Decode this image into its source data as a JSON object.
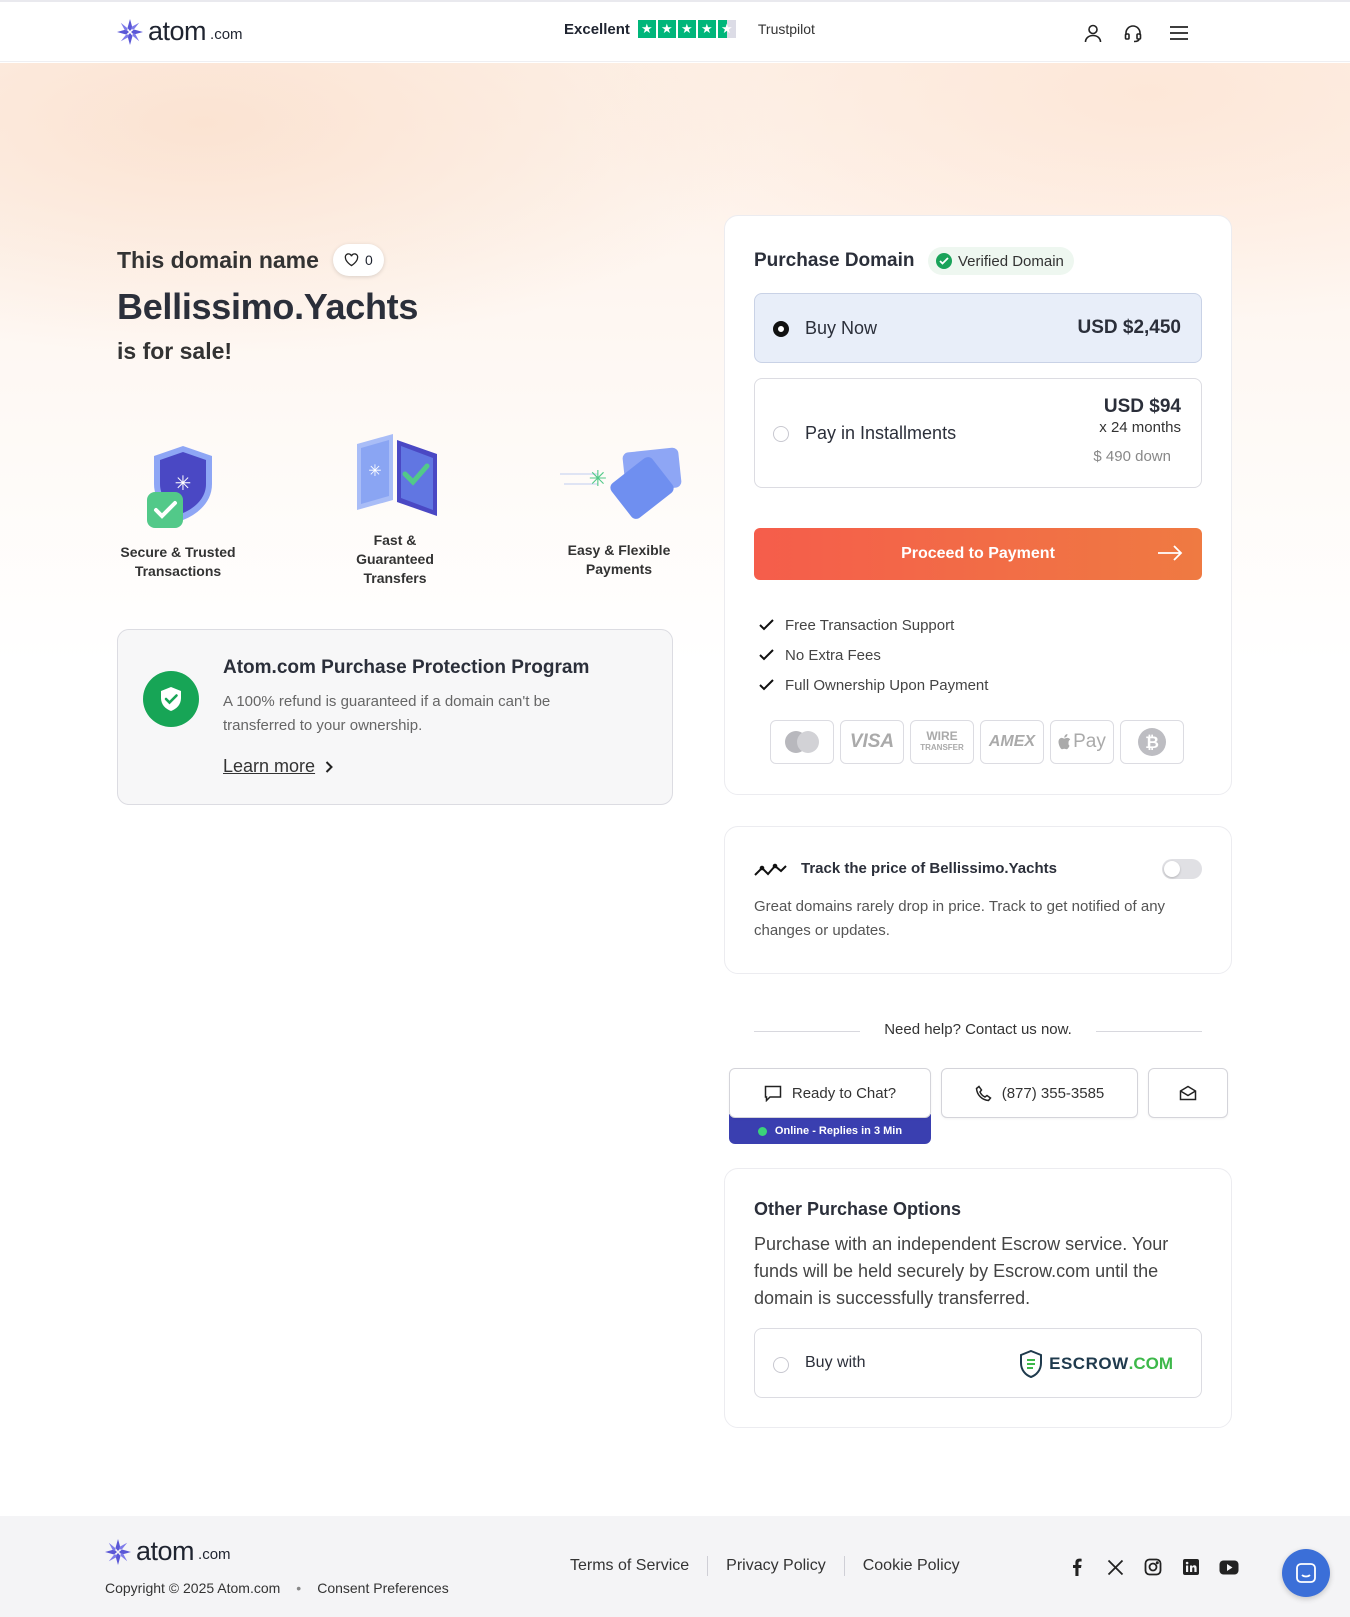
{
  "header": {
    "logo_word": "atom",
    "logo_tld": ".com",
    "trustpilot_rating": "Excellent",
    "trustpilot_label": "Trustpilot",
    "icons": [
      "user-icon",
      "headset-icon",
      "menu-icon"
    ]
  },
  "hero": {
    "intro": "This domain name",
    "favorites_count": "0",
    "domain": "Bellissimo.Yachts",
    "for_sale": "is for sale!"
  },
  "features": [
    {
      "label_line1": "Secure & Trusted",
      "label_line2": "Transactions",
      "label_line3": ""
    },
    {
      "label_line1": "Fast &",
      "label_line2": "Guaranteed",
      "label_line3": "Transfers"
    },
    {
      "label_line1": "Easy & Flexible",
      "label_line2": "Payments",
      "label_line3": ""
    }
  ],
  "protection": {
    "title": "Atom.com Purchase Protection Program",
    "description": "A 100% refund is guaranteed if a domain can't be transferred to your ownership.",
    "link": "Learn more"
  },
  "purchase": {
    "title": "Purchase Domain",
    "verified_label": "Verified Domain",
    "buy_now": {
      "label": "Buy Now",
      "price": "USD $2,450",
      "selected": true
    },
    "installments": {
      "label": "Pay in Installments",
      "price": "USD $94",
      "term": "x 24 months",
      "down": "$ 490 down",
      "selected": false
    },
    "proceed_label": "Proceed to Payment",
    "bullets": [
      "Free Transaction Support",
      "No Extra Fees",
      "Full Ownership Upon Payment"
    ],
    "payment_methods": [
      "mastercard-icon",
      "visa-icon",
      "wire-transfer-icon",
      "amex-icon",
      "apple-pay-icon",
      "bitcoin-icon"
    ],
    "payment_labels": {
      "visa": "VISA",
      "wire": "WIRE",
      "wire_sub": "TRANSFER",
      "amex": "AMEX",
      "applepay": "Pay"
    }
  },
  "track": {
    "title": "Track the price of Bellissimo.Yachts",
    "description": "Great domains rarely drop in price. Track to get notified of any changes or updates.",
    "enabled": false
  },
  "contact": {
    "heading": "Need help? Contact us now.",
    "chat_label": "Ready to Chat?",
    "online_status": "Online - Replies in 3 Min",
    "phone": "(877) 355-3585"
  },
  "other_options": {
    "title": "Other Purchase Options",
    "description": "Purchase with an independent Escrow service. Your funds will be held securely by Escrow.com until the domain is successfully transferred.",
    "buy_with_label": "Buy with",
    "escrow_brand": "ESCROW",
    "escrow_tld": ".COM"
  },
  "footer": {
    "copyright": "Copyright © 2025 Atom.com",
    "consent": "Consent Preferences",
    "links": [
      "Terms of Service",
      "Privacy Policy",
      "Cookie Policy"
    ],
    "socials": [
      "facebook-icon",
      "x-icon",
      "instagram-icon",
      "linkedin-icon",
      "youtube-icon"
    ]
  },
  "colors": {
    "accent_gradient_start": "#f55d4b",
    "accent_gradient_end": "#ef7a42",
    "brand_purple": "#4a48c4",
    "verified_green": "#1aa35a",
    "trustpilot_green": "#00b67a"
  }
}
